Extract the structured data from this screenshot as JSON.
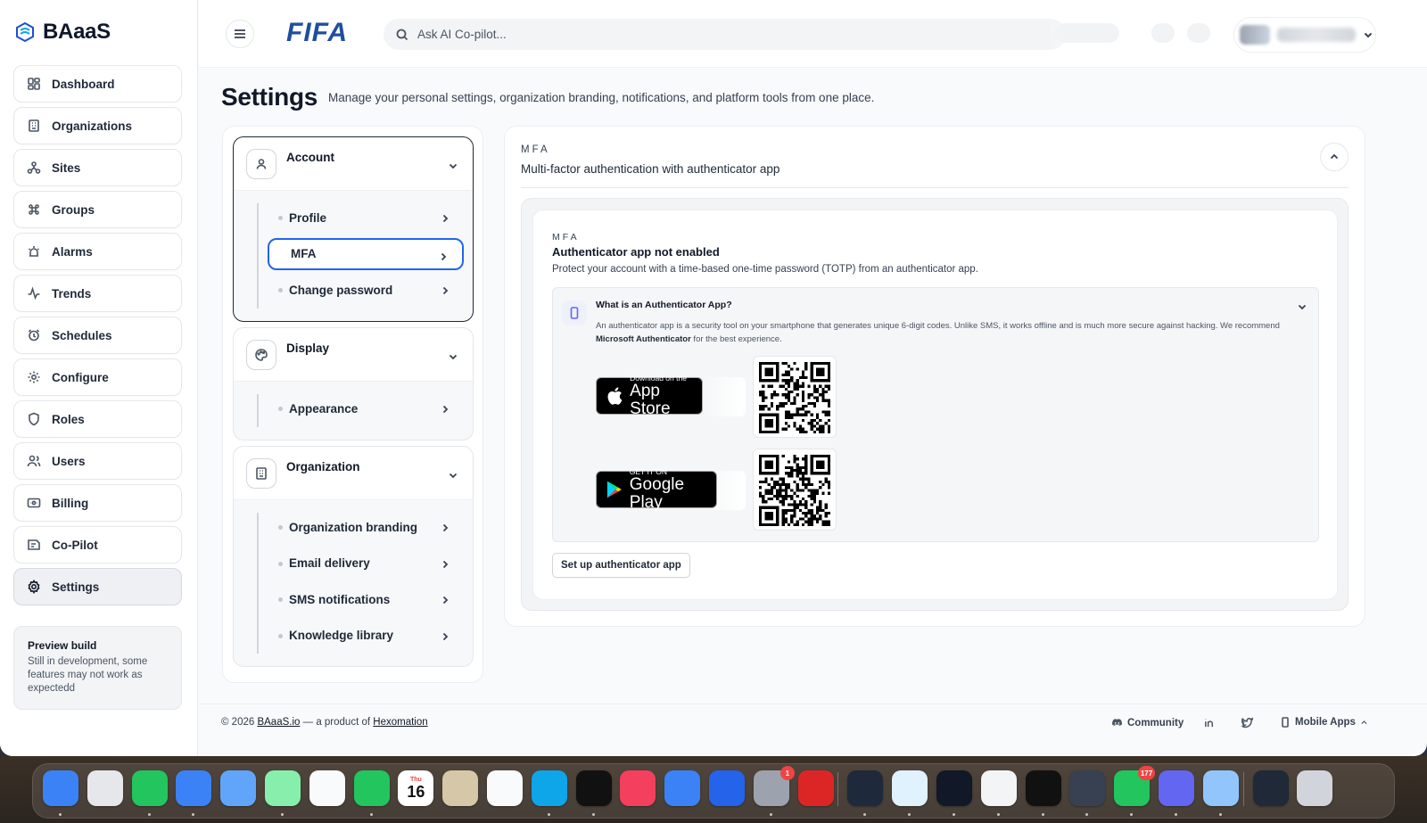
{
  "brand": {
    "name": "BAaaS"
  },
  "header": {
    "logo_text": "FIFA",
    "search_placeholder": "Ask AI Co-pilot..."
  },
  "sidebar": {
    "items": [
      {
        "label": "Dashboard",
        "icon": "dashboard-icon"
      },
      {
        "label": "Organizations",
        "icon": "building-icon"
      },
      {
        "label": "Sites",
        "icon": "sites-icon"
      },
      {
        "label": "Groups",
        "icon": "command-icon"
      },
      {
        "label": "Alarms",
        "icon": "alarm-icon"
      },
      {
        "label": "Trends",
        "icon": "trend-icon"
      },
      {
        "label": "Schedules",
        "icon": "clock-icon"
      },
      {
        "label": "Configure",
        "icon": "gear-icon"
      },
      {
        "label": "Roles",
        "icon": "shield-icon"
      },
      {
        "label": "Users",
        "icon": "users-icon"
      },
      {
        "label": "Billing",
        "icon": "billing-icon"
      },
      {
        "label": "Co-Pilot",
        "icon": "copilot-icon"
      },
      {
        "label": "Settings",
        "icon": "settings-icon",
        "active": true
      }
    ],
    "preview": {
      "title": "Preview build",
      "text": "Still in development, some features may not work as expectedd"
    }
  },
  "page": {
    "title": "Settings",
    "subtitle": "Manage your personal settings, organization branding, notifications, and platform tools from one place."
  },
  "settings_menu": {
    "groups": [
      {
        "label": "Account",
        "icon": "user-icon",
        "items": [
          "Profile",
          "MFA",
          "Change password"
        ],
        "selected": "MFA"
      },
      {
        "label": "Display",
        "icon": "palette-icon",
        "items": [
          "Appearance"
        ]
      },
      {
        "label": "Organization",
        "icon": "building-icon",
        "items": [
          "Organization branding",
          "Email delivery",
          "SMS notifications",
          "Knowledge library"
        ]
      }
    ]
  },
  "mfa": {
    "eyebrow": "MFA",
    "title": "Multi-factor authentication with authenticator app",
    "card": {
      "eyebrow": "MFA",
      "status": "Authenticator app not enabled",
      "description": "Protect your account with a time-based one-time password (TOTP) from an authenticator app.",
      "what_title": "What is an Authenticator App?",
      "what_text_before": "An authenticator app is a security tool on your smartphone that generates unique 6-digit codes. Unlike SMS, it works offline and is much more secure against hacking. We recommend ",
      "what_text_bold": "Microsoft Authenticator",
      "what_text_after": " for the best experience.",
      "app_store": {
        "small": "Download on the",
        "big": "App Store"
      },
      "google_play": {
        "small": "GET IT ON",
        "big": "Google Play"
      },
      "setup_button": "Set up authenticator app"
    }
  },
  "footer": {
    "copyright": "© 2026",
    "site_link": "BAaaS.io",
    "middle": "— a product of",
    "company_link": "Hexomation",
    "community": "Community",
    "mobile_apps": "Mobile Apps"
  },
  "dock": {
    "calendar_day": "Thu",
    "calendar_date": "16",
    "settings_badge": "1",
    "whatsapp_badge": "177",
    "apps": [
      {
        "name": "finder",
        "color": "#3b82f6"
      },
      {
        "name": "launchpad",
        "color": "#e5e7eb"
      },
      {
        "name": "messages",
        "color": "#22c55e"
      },
      {
        "name": "safari",
        "color": "#3b82f6"
      },
      {
        "name": "mail",
        "color": "#60a5fa"
      },
      {
        "name": "maps",
        "color": "#86efac"
      },
      {
        "name": "photos",
        "color": "#f9fafb"
      },
      {
        "name": "facetime",
        "color": "#22c55e"
      },
      {
        "name": "calendar",
        "color": "#ffffff"
      },
      {
        "name": "contacts",
        "color": "#d6c7a8"
      },
      {
        "name": "reminders",
        "color": "#f9fafb"
      },
      {
        "name": "freeform",
        "color": "#0ea5e9"
      },
      {
        "name": "tv",
        "color": "#111111"
      },
      {
        "name": "music",
        "color": "#f43f5e"
      },
      {
        "name": "keynote",
        "color": "#3b82f6"
      },
      {
        "name": "app-store",
        "color": "#2563eb"
      },
      {
        "name": "system-settings",
        "color": "#9ca3af"
      },
      {
        "name": "acrobat",
        "color": "#dc2626"
      },
      {
        "name": "vectornator",
        "color": "#1e293b"
      },
      {
        "name": "xcode-tools",
        "color": "#e0f2fe"
      },
      {
        "name": "terminal",
        "color": "#111827"
      },
      {
        "name": "chrome",
        "color": "#f3f4f6"
      },
      {
        "name": "figma-like",
        "color": "#111111"
      },
      {
        "name": "sublime",
        "color": "#374151"
      },
      {
        "name": "whatsapp",
        "color": "#22c55e"
      },
      {
        "name": "teams",
        "color": "#6366f1"
      },
      {
        "name": "disk-utility",
        "color": "#93c5fd"
      },
      {
        "name": "device",
        "color": "#1f2937"
      },
      {
        "name": "trash",
        "color": "#d1d5db"
      }
    ]
  }
}
